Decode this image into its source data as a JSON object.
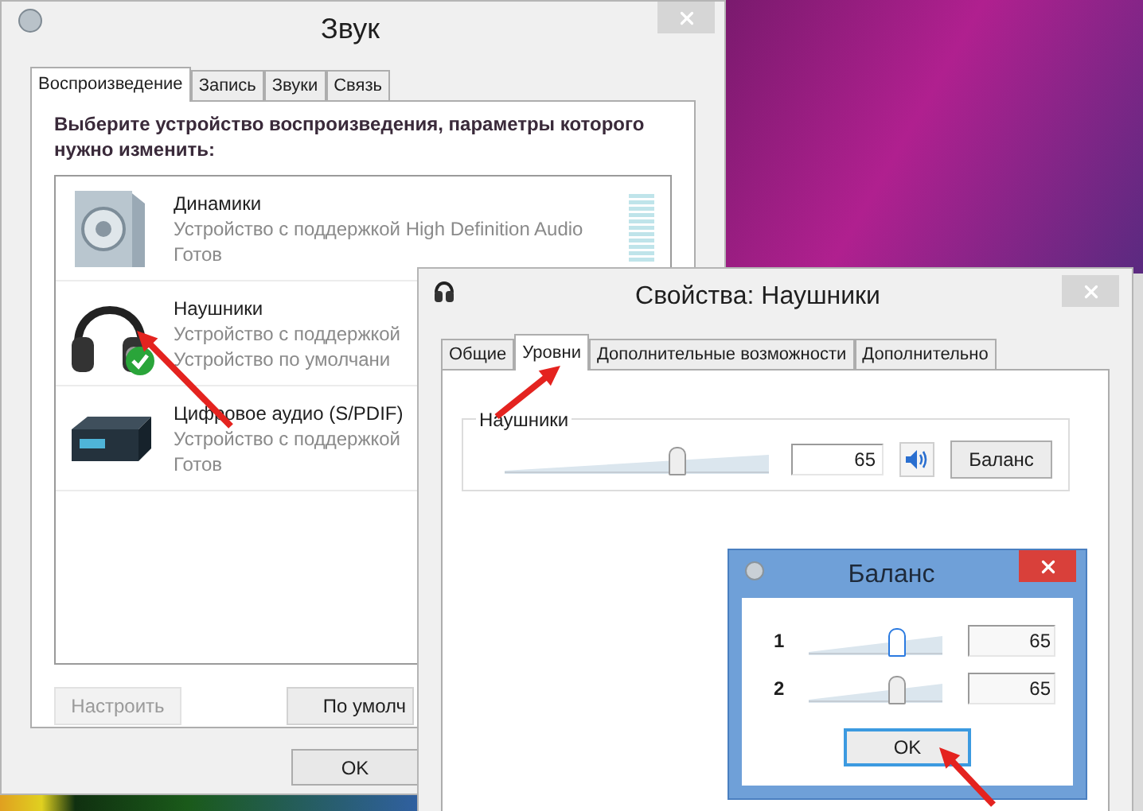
{
  "sound_window": {
    "title": "Звук",
    "tabs": [
      {
        "label": "Воспроизведение",
        "selected": true
      },
      {
        "label": "Запись",
        "selected": false
      },
      {
        "label": "Звуки",
        "selected": false
      },
      {
        "label": "Связь",
        "selected": false
      }
    ],
    "prompt": "Выберите устройство воспроизведения, параметры которого нужно изменить:",
    "devices": [
      {
        "kind": "speaker",
        "name": "Динамики",
        "description": "Устройство с поддержкой High Definition Audio",
        "status": "Готов",
        "default": false
      },
      {
        "kind": "headphones",
        "name": "Наушники",
        "description": "Устройство с поддержкой",
        "status": "Устройство по умолчани",
        "default": true
      },
      {
        "kind": "digital",
        "name": "Цифровое аудио (S/PDIF)",
        "description": "Устройство с поддержкой",
        "status": "Готов",
        "default": false
      }
    ],
    "buttons": [
      {
        "label": "Настроить",
        "disabled": true
      },
      {
        "label": "По умолч",
        "disabled": false
      }
    ],
    "ok": "OK"
  },
  "properties_window": {
    "title": "Свойства: Наушники",
    "tabs": [
      {
        "label": "Общие",
        "selected": false
      },
      {
        "label": "Уровни",
        "selected": true
      },
      {
        "label": "Дополнительные возможности",
        "selected": false
      },
      {
        "label": "Дополнительно",
        "selected": false
      }
    ],
    "group": "Наушники",
    "level": 0.65,
    "value": "65",
    "balance_button": "Баланс"
  },
  "balance_window": {
    "title": "Баланс",
    "channels": [
      {
        "label": "1",
        "level": 0.65,
        "value": "65",
        "focused": true
      },
      {
        "label": "2",
        "level": 0.65,
        "value": "65",
        "focused": false
      }
    ],
    "ok": "OK"
  }
}
